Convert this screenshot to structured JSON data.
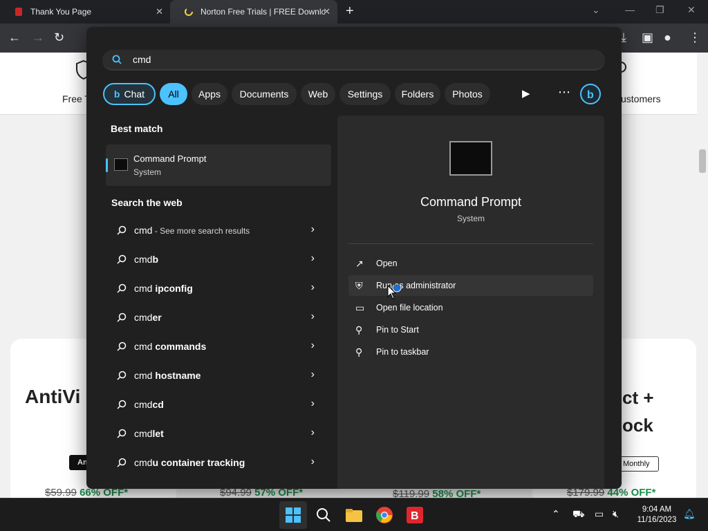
{
  "browser": {
    "tabs": [
      {
        "title": "Thank You Page"
      },
      {
        "title": "Norton Free Trials | FREE Downlo"
      }
    ]
  },
  "page_behind": {
    "header_left": "Free T",
    "header_right": "ustomers",
    "card_title_left": "AntiVi",
    "card_title_right_1": "ct +",
    "card_title_right_2": "ock",
    "badge_left": "An",
    "badge_right": "Monthly",
    "prices": [
      {
        "old": "$59.99",
        "off": "66% OFF*"
      },
      {
        "old": "$94.99",
        "off": "57% OFF*"
      },
      {
        "old": "$119.99",
        "off": "58% OFF*"
      },
      {
        "old": "$179.99",
        "off": "44% OFF*"
      }
    ]
  },
  "search": {
    "query": "cmd",
    "filters": [
      "Chat",
      "All",
      "Apps",
      "Documents",
      "Web",
      "Settings",
      "Folders",
      "Photos"
    ],
    "best_match_heading": "Best match",
    "best_match": {
      "name": "Command Prompt",
      "type": "System"
    },
    "web_heading": "Search the web",
    "web_results": [
      {
        "plain": "cmd",
        "bold": "",
        "small": " - See more search results"
      },
      {
        "plain": "cmd",
        "bold": "b",
        "small": ""
      },
      {
        "plain": "cmd ",
        "bold": "ipconfig",
        "small": ""
      },
      {
        "plain": "cmd",
        "bold": "er",
        "small": ""
      },
      {
        "plain": "cmd ",
        "bold": "commands",
        "small": ""
      },
      {
        "plain": "cmd ",
        "bold": "hostname",
        "small": ""
      },
      {
        "plain": "cmd",
        "bold": "cd",
        "small": ""
      },
      {
        "plain": "cmd",
        "bold": "let",
        "small": ""
      },
      {
        "plain": "cmd",
        "bold": "u container tracking",
        "small": ""
      }
    ],
    "preview": {
      "title": "Command Prompt",
      "subtitle": "System",
      "actions": [
        "Open",
        "Run as administrator",
        "Open file location",
        "Pin to Start",
        "Pin to taskbar"
      ]
    }
  },
  "taskbar": {
    "time": "9:04 AM",
    "date": "11/16/2023"
  },
  "colors": {
    "accent": "#4cc2ff",
    "panel_bg": "#202020",
    "discount_green": "#1a8f4a"
  }
}
